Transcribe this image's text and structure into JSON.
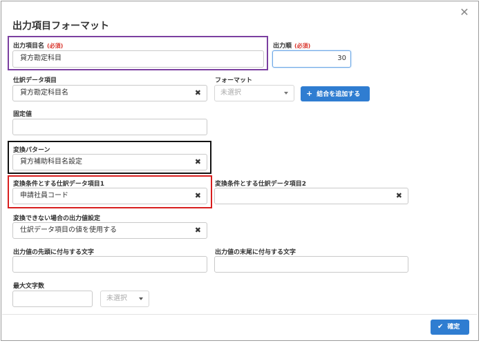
{
  "dialog": {
    "title": "出力項目フォーマット",
    "close_glyph": "✕"
  },
  "fields": {
    "output_item_name": {
      "label": "出力項目名",
      "required": "(必須)",
      "value": "貸方勘定科目"
    },
    "output_order": {
      "label": "出力順",
      "required": "(必須)",
      "value": "30"
    },
    "journal_item": {
      "label": "仕訳データ項目",
      "value": "貸方勘定科目名"
    },
    "format": {
      "label": "フォーマット",
      "selected": "未選択"
    },
    "add_join_button": {
      "label": "結合を追加する"
    },
    "fixed_value": {
      "label": "固定値",
      "value": ""
    },
    "conversion_pattern": {
      "label": "変換パターン",
      "value": "貸方補助科目名設定"
    },
    "cond_journal_item1": {
      "label": "変換条件とする仕訳データ項目1",
      "value": "申請社員コード"
    },
    "cond_journal_item2": {
      "label": "変換条件とする仕訳データ項目2",
      "value": ""
    },
    "unconvertible_output": {
      "label": "変換できない場合の出力値設定",
      "value": "仕訳データ項目の値を使用する"
    },
    "prefix_chars": {
      "label": "出力値の先頭に付与する文字",
      "value": ""
    },
    "suffix_chars": {
      "label": "出力値の末尾に付与する文字",
      "value": ""
    },
    "max_chars": {
      "label": "最大文字数",
      "value": "",
      "unit_selected": "未選択"
    }
  },
  "icons": {
    "clear": "✖",
    "plus": "+",
    "check": "✔"
  },
  "footer": {
    "confirm_label": "確定"
  },
  "highlight_colors": {
    "purple": "#7b3fa0",
    "black": "#111111",
    "red": "#d81e1e",
    "accent": "#2f7dd1"
  }
}
